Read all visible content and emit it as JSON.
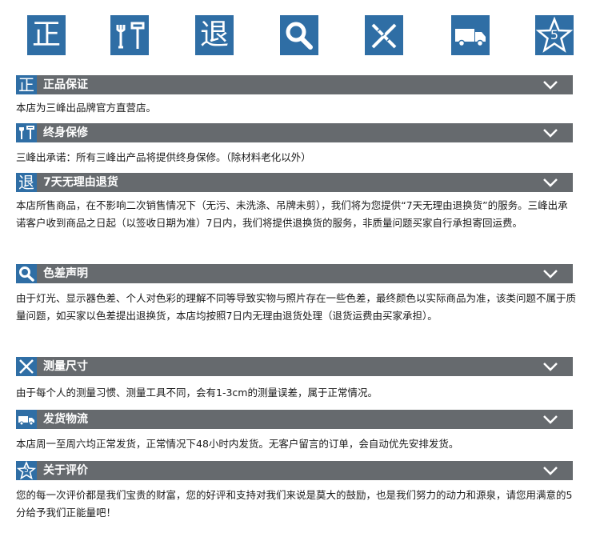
{
  "top_icons": [
    {
      "icon": "zheng-char-icon",
      "glyph": "正"
    },
    {
      "icon": "tools-icon",
      "glyph": ""
    },
    {
      "icon": "tui-char-icon",
      "glyph": "退"
    },
    {
      "icon": "magnifier-icon",
      "glyph": ""
    },
    {
      "icon": "ruler-pencil-icon",
      "glyph": ""
    },
    {
      "icon": "truck-icon",
      "glyph": ""
    },
    {
      "icon": "star-5-icon",
      "glyph": "5"
    }
  ],
  "sections": [
    {
      "title": "正品保证",
      "icon_glyph": "正",
      "text": "本店为三峰出品牌官方直营店。"
    },
    {
      "title": "终身保修",
      "icon_glyph": "",
      "text": "三峰出承诺：所有三峰出产品将提供终身保修。（除材料老化以外）"
    },
    {
      "title": "7天无理由退货",
      "icon_glyph": "退",
      "text": "本店所售商品，在不影响二次销售情况下（无污、未洗涤、吊牌未剪），我们将为您提供“7天无理由退换货”的服务。三峰出承诺客户收到商品之日起（以签收日期为准）7日内，我们将提供退换货的服务，非质量问题买家自行承担寄回运费。"
    },
    {
      "title": "色差声明",
      "icon_glyph": "",
      "text": "由于灯光、显示器色差、个人对色彩的理解不同等导致实物与照片存在一些色差，最终颜色以实际商品为准，该类问题不属于质量问题，如买家以色差提出退换货，本店均按照7日内无理由退货处理（退货运费由买家承担）。"
    },
    {
      "title": "测量尺寸",
      "icon_glyph": "",
      "text": "由于每个人的测量习惯、测量工具不同，会有1-3cm的测量误差，属于正常情况。"
    },
    {
      "title": "发货物流",
      "icon_glyph": "",
      "text": "本店周一至周六均正常发货，正常情况下48小时内发货。无客户留言的订单，会自动优先安排发货。"
    },
    {
      "title": "关于评价",
      "icon_glyph": "5",
      "text": "您的每一次评价都是我们宝贵的财富，您的好评和支持对我们来说是莫大的鼓励，也是我们努力的动力和源泉，请您用满意的5分给予我们正能量吧！"
    }
  ],
  "colors": {
    "accent": "#2f6ea5",
    "bar": "#666a6e",
    "text": "#1a1a1a"
  }
}
